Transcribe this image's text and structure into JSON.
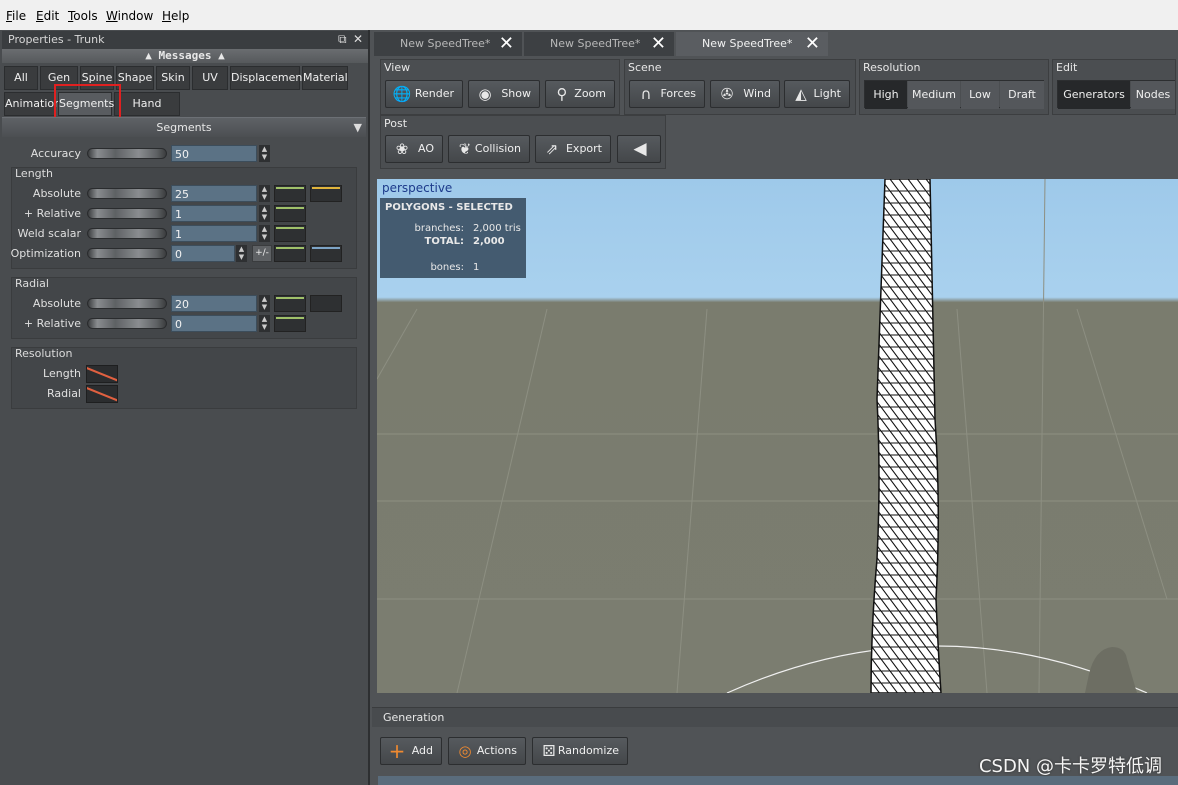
{
  "menu": [
    "File",
    "Edit",
    "Tools",
    "Window",
    "Help"
  ],
  "panel": {
    "title": "Properties - Trunk",
    "float_icon": "⧉",
    "close_icon": "✕",
    "messages": "▲ Messages ▲",
    "tabs_row1": [
      "All",
      "Gen",
      "Spine",
      "Shape",
      "Skin",
      "UV",
      "Displacement",
      "Material"
    ],
    "tabs_row2": [
      "Animation",
      "Segments",
      "Hand Drawn"
    ],
    "section": "Segments",
    "accuracy": {
      "label": "Accuracy",
      "value": "50"
    },
    "length": {
      "title": "Length",
      "absolute": {
        "label": "Absolute",
        "value": "25"
      },
      "relative": {
        "label": "+ Relative",
        "value": "1"
      },
      "weld": {
        "label": "Weld scalar",
        "value": "1"
      },
      "optimization": {
        "label": "Optimization",
        "value": "0",
        "pm": "+/-"
      }
    },
    "radial": {
      "title": "Radial",
      "absolute": {
        "label": "Absolute",
        "value": "20"
      },
      "relative": {
        "label": "+ Relative",
        "value": "0"
      }
    },
    "resolution": {
      "title": "Resolution",
      "length": "Length",
      "radial": "Radial"
    }
  },
  "doc_tabs": [
    "New SpeedTree*",
    "New SpeedTree*",
    "New SpeedTree*"
  ],
  "toolbar": {
    "view": {
      "title": "View",
      "render": "Render",
      "show": "Show",
      "zoom": "Zoom"
    },
    "scene": {
      "title": "Scene",
      "forces": "Forces",
      "wind": "Wind",
      "light": "Light"
    },
    "resolution": {
      "title": "Resolution",
      "high": "High",
      "medium": "Medium",
      "low": "Low",
      "draft": "Draft"
    },
    "edit": {
      "title": "Edit",
      "generators": "Generators",
      "nodes": "Nodes"
    },
    "post": {
      "title": "Post",
      "ao": "AO",
      "collision": "Collision",
      "export": "Export"
    }
  },
  "viewport": {
    "label": "perspective",
    "stats_title": "POLYGONS - SELECTED",
    "branches_label": "branches:",
    "branches_value": "2,000 tris",
    "total_label": "TOTAL:",
    "total_value": "2,000",
    "bones_label": "bones:",
    "bones_value": "1"
  },
  "generation": {
    "title": "Generation",
    "add": "Add",
    "actions": "Actions",
    "randomize": "Randomize"
  },
  "watermark": "CSDN @卡卡罗特低调",
  "colors": {
    "highlight": "#e02020",
    "field": "#5b7285",
    "sky": "#a9d1ee",
    "ground": "#7b7d70"
  }
}
